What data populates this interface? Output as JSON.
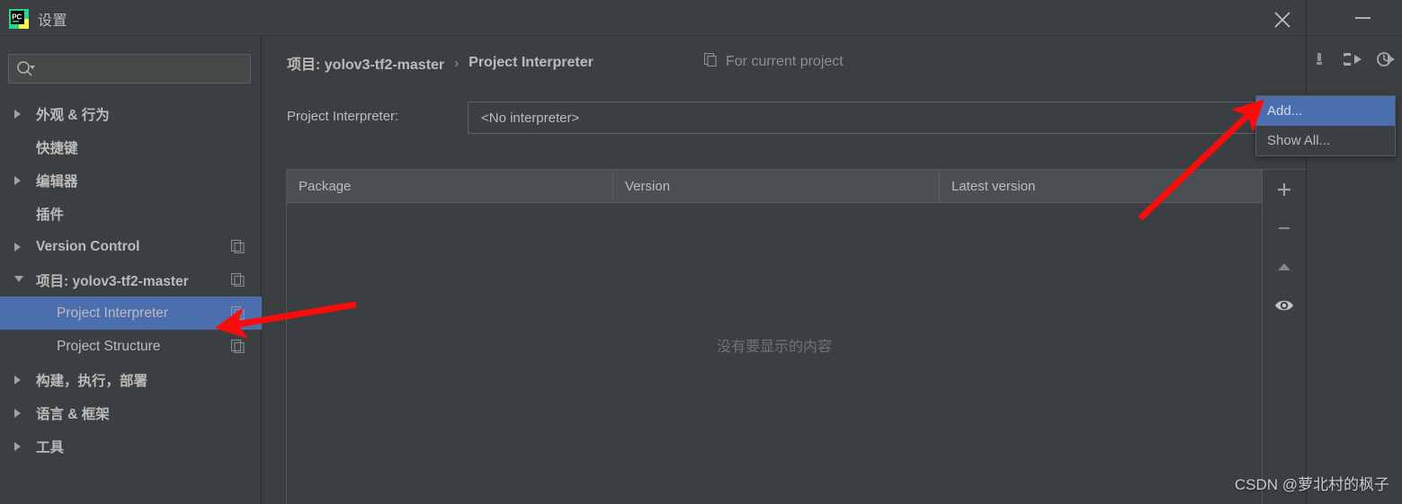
{
  "dialog": {
    "title": "设置",
    "logo_icon": "pycharm-logo-icon",
    "close_icon": "close-icon"
  },
  "ide": {
    "minimize_icon": "minimize-icon",
    "toolbar_icons": [
      "build-icon",
      "run-icon",
      "run-with-coverage-icon"
    ]
  },
  "search": {
    "placeholder": "",
    "value": "",
    "icon": "search-icon"
  },
  "sidebar": {
    "items": [
      {
        "label": "外观 & 行为",
        "level": 1,
        "arrow": "collapsed",
        "bold": true,
        "selected": false,
        "copy_icon": false
      },
      {
        "label": "快捷键",
        "level": 1,
        "arrow": "none",
        "bold": true,
        "selected": false,
        "copy_icon": false
      },
      {
        "label": "编辑器",
        "level": 1,
        "arrow": "collapsed",
        "bold": true,
        "selected": false,
        "copy_icon": false
      },
      {
        "label": "插件",
        "level": 1,
        "arrow": "none",
        "bold": true,
        "selected": false,
        "copy_icon": false
      },
      {
        "label": "Version Control",
        "level": 1,
        "arrow": "collapsed",
        "bold": true,
        "selected": false,
        "copy_icon": true
      },
      {
        "label": "项目: yolov3-tf2-master",
        "level": 1,
        "arrow": "expanded",
        "bold": true,
        "selected": false,
        "copy_icon": true
      },
      {
        "label": "Project Interpreter",
        "level": 2,
        "arrow": "none",
        "bold": false,
        "selected": true,
        "copy_icon": true
      },
      {
        "label": "Project Structure",
        "level": 2,
        "arrow": "none",
        "bold": false,
        "selected": false,
        "copy_icon": true
      },
      {
        "label": "构建，执行，部署",
        "level": 1,
        "arrow": "collapsed",
        "bold": true,
        "selected": false,
        "copy_icon": false
      },
      {
        "label": "语言 & 框架",
        "level": 1,
        "arrow": "collapsed",
        "bold": true,
        "selected": false,
        "copy_icon": false
      },
      {
        "label": "工具",
        "level": 1,
        "arrow": "collapsed",
        "bold": true,
        "selected": false,
        "copy_icon": false
      }
    ]
  },
  "main": {
    "breadcrumb": {
      "project": "项目: yolov3-tf2-master",
      "separator": "›",
      "page": "Project Interpreter"
    },
    "for_current_project": {
      "label": "For current project",
      "icon": "copy-icon"
    },
    "interpreter": {
      "label": "Project Interpreter:",
      "value": "<No interpreter>",
      "arrow_icon": "chevron-down-icon"
    },
    "table": {
      "columns": [
        "Package",
        "Version",
        "Latest version"
      ],
      "rows": [],
      "empty_text": "没有要显示的内容"
    },
    "table_toolbar": [
      {
        "icon": "plus-icon",
        "name": "add-package-button"
      },
      {
        "icon": "minus-icon",
        "name": "remove-package-button"
      },
      {
        "icon": "up-arrow-icon",
        "name": "upgrade-package-button"
      },
      {
        "icon": "eye-icon",
        "name": "show-early-releases-button"
      }
    ]
  },
  "popup": {
    "items": [
      {
        "label": "Add...",
        "highlighted": true
      },
      {
        "label": "Show All...",
        "highlighted": false
      }
    ]
  },
  "watermark": "CSDN @萝北村的枫子",
  "colors": {
    "background": "#3c3f41",
    "selection_blue": "#4b6eaf",
    "text": "#bbbbbb",
    "muted_text": "#8b8f91",
    "border": "#5a5d5f",
    "annotation_red": "#fb0b0b",
    "header_row": "#4b4f51"
  }
}
